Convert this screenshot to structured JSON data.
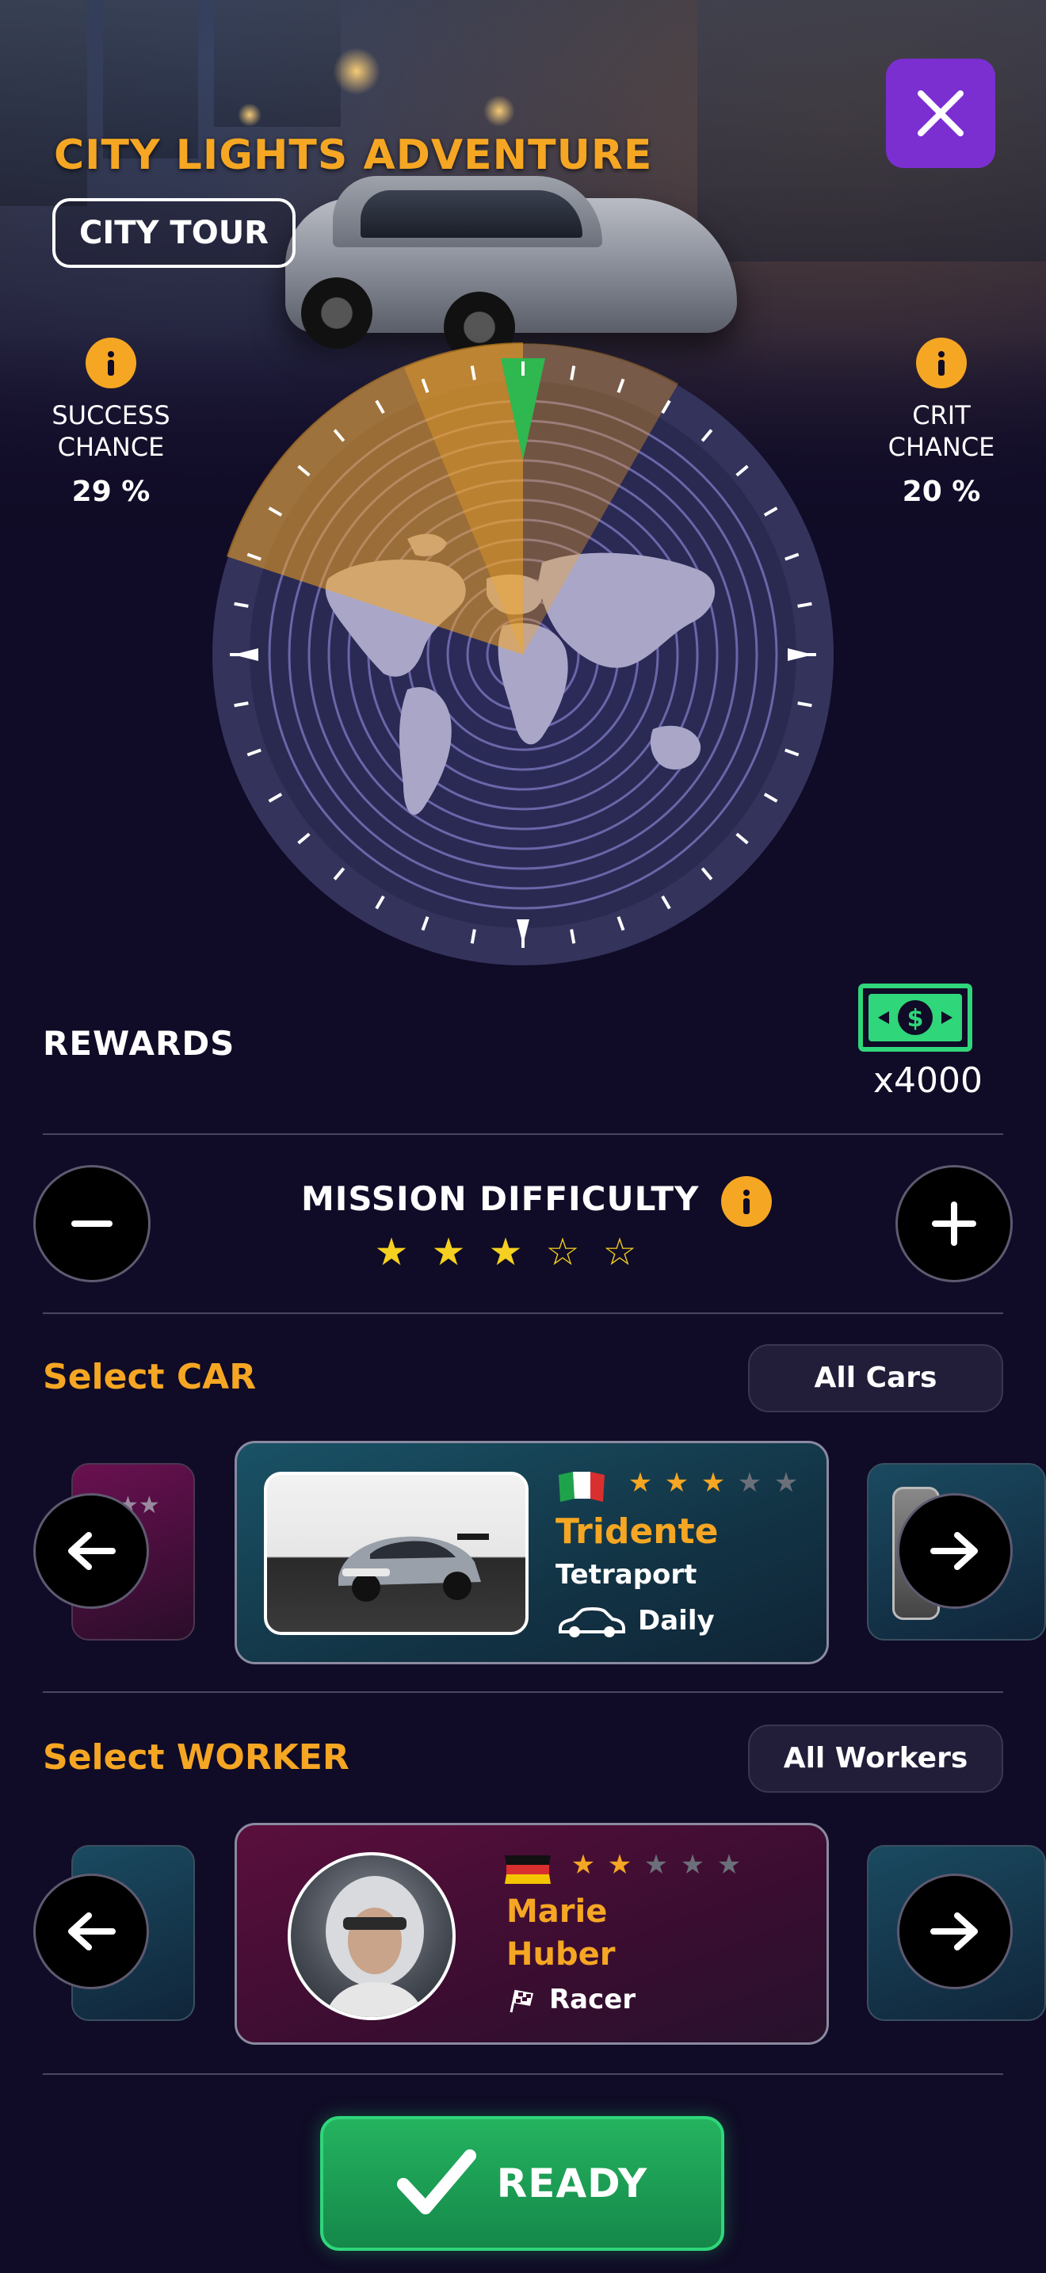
{
  "header": {
    "mission_title": "CITY LIGHTS ADVENTURE",
    "mission_tag": "CITY TOUR",
    "close_icon": "close-icon"
  },
  "stats": {
    "success": {
      "label_line1": "SUCCESS",
      "label_line2": "CHANCE",
      "value": "29 %"
    },
    "crit": {
      "label_line1": "CRIT",
      "label_line2": "CHANCE",
      "value": "20 %"
    }
  },
  "rewards": {
    "label": "REWARDS",
    "amount": "x4000",
    "icon": "cash-icon"
  },
  "difficulty": {
    "label": "MISSION DIFFICULTY",
    "rating": 3,
    "max": 5,
    "minus_icon": "minus-icon",
    "plus_icon": "plus-icon"
  },
  "car_section": {
    "title": "Select CAR",
    "filter_label": "All Cars",
    "selected": {
      "name": "Tridente",
      "brand": "Tetraport",
      "category": "Daily",
      "rating": 3,
      "max": 5,
      "flag": "italy-flag"
    }
  },
  "worker_section": {
    "title": "Select WORKER",
    "filter_label": "All Workers",
    "selected": {
      "first_name": "Marie",
      "last_name": "Huber",
      "role": "Racer",
      "rating": 2,
      "max": 5,
      "flag": "germany-flag"
    }
  },
  "ready_button": {
    "label": "READY"
  },
  "colors": {
    "accent_orange": "#f5a623",
    "accent_purple": "#7b2fd1",
    "accent_green": "#24b35f",
    "background": "#100b26",
    "star_yellow": "#f5d020"
  }
}
